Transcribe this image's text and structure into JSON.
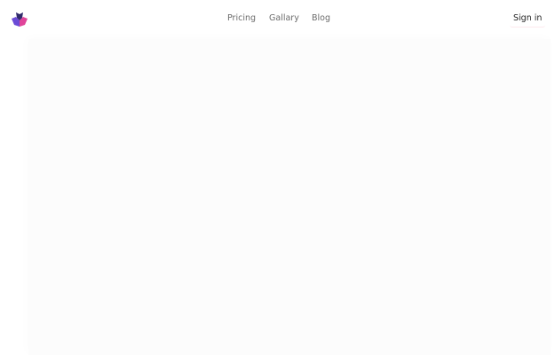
{
  "header": {
    "logo_icon": "three-petal-logo-icon",
    "nav": {
      "pricing": "Pricing",
      "gallery": "Gallary",
      "blog": "Blog"
    },
    "sign_in": "Sign in"
  },
  "colors": {
    "logo_left": "#6b4bd6",
    "logo_middle": "#2f2a6b",
    "logo_right": "#e0449a",
    "nav_text": "#6b6b6b",
    "content_bg": "#fcfcfc"
  }
}
